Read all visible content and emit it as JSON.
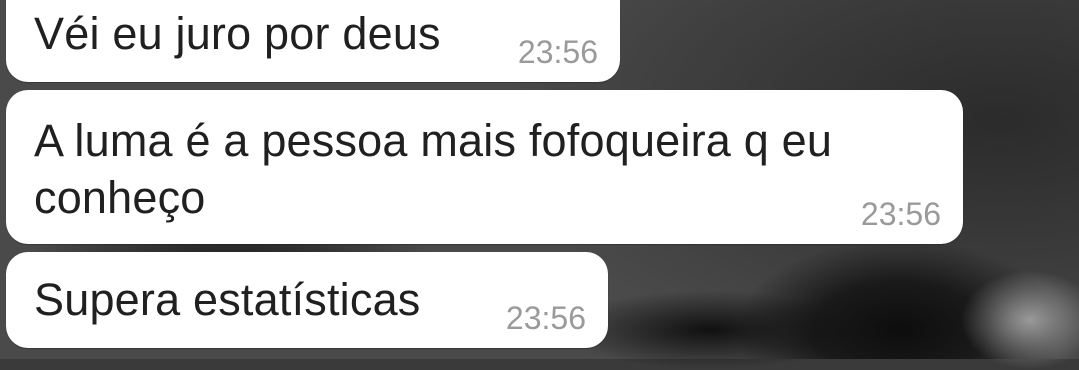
{
  "chat": {
    "messages": [
      {
        "text": "Véi eu juro por deus",
        "time": "23:56"
      },
      {
        "text": "A luma é a pessoa mais fofoqueira q eu conheço",
        "time": "23:56"
      },
      {
        "text": "Supera estatísticas",
        "time": "23:56"
      }
    ]
  },
  "colors": {
    "bubble_bg": "#ffffff",
    "text": "#202020",
    "timestamp": "#9a9a9a"
  }
}
